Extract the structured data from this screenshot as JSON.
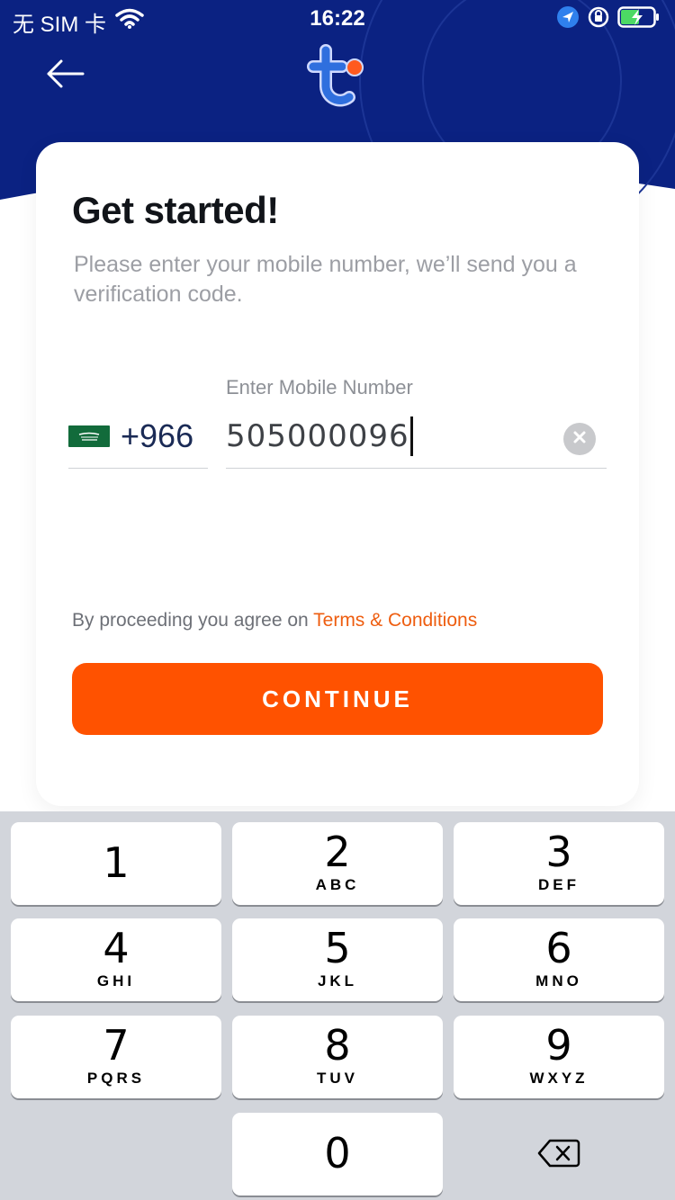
{
  "status_bar": {
    "carrier": "无 SIM 卡",
    "time": "16:22"
  },
  "header": {
    "back_icon": "arrow-left-icon",
    "logo_icon": "brand-t-logo"
  },
  "card": {
    "title": "Get started!",
    "subtitle": "Please enter your mobile number, we’ll send you a verification code.",
    "country": {
      "flag_icon": "saudi-flag-icon",
      "dial_code": "+966"
    },
    "phone": {
      "label": "Enter Mobile Number",
      "value": "505000096"
    },
    "terms": {
      "prefix": "By proceeding you agree on ",
      "link": "Terms & Conditions"
    },
    "continue_label": "CONTINUE"
  },
  "keypad": {
    "keys": [
      {
        "digit": "1",
        "letters": ""
      },
      {
        "digit": "2",
        "letters": "ABC"
      },
      {
        "digit": "3",
        "letters": "DEF"
      },
      {
        "digit": "4",
        "letters": "GHI"
      },
      {
        "digit": "5",
        "letters": "JKL"
      },
      {
        "digit": "6",
        "letters": "MNO"
      },
      {
        "digit": "7",
        "letters": "PQRS"
      },
      {
        "digit": "8",
        "letters": "TUV"
      },
      {
        "digit": "9",
        "letters": "WXYZ"
      },
      {
        "digit": "0",
        "letters": ""
      }
    ],
    "delete_icon": "backspace-icon"
  },
  "colors": {
    "header_bg": "#0b2282",
    "accent": "#ff5200",
    "link": "#ee5d0f",
    "keypad_bg": "#d2d5db"
  }
}
